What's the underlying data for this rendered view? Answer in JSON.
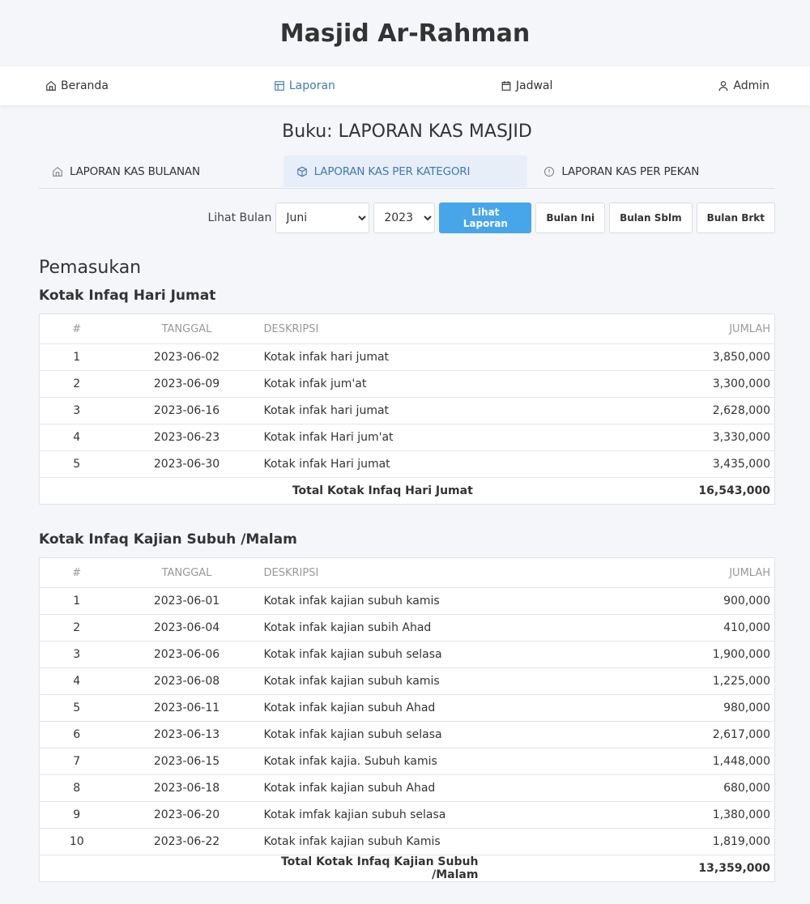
{
  "app_title": "Masjid Ar-Rahman",
  "nav": [
    {
      "label": "Beranda",
      "icon": "home-icon"
    },
    {
      "label": "Laporan",
      "icon": "layout-icon",
      "active": true
    },
    {
      "label": "Jadwal",
      "icon": "calendar-icon"
    },
    {
      "label": "Admin",
      "icon": "user-icon"
    }
  ],
  "page_title": "Buku: LAPORAN KAS MASJID",
  "tabs": [
    {
      "label": "LAPORAN KAS BULANAN",
      "icon": "home-icon"
    },
    {
      "label": "LAPORAN KAS PER KATEGORI",
      "icon": "box-icon",
      "active": true
    },
    {
      "label": "LAPORAN KAS PER PEKAN",
      "icon": "alert-circle-icon"
    }
  ],
  "controls": {
    "label": "Lihat Bulan",
    "month": "Juni",
    "year": "2023",
    "view": "Lihat Laporan",
    "this_month": "Bulan Ini",
    "prev": "Bulan Sblm",
    "next": "Bulan Brkt"
  },
  "accent": "#47a6ea",
  "section": "Pemasukan",
  "columns": [
    "#",
    "TANGGAL",
    "DESKRIPSI",
    "JUMLAH"
  ],
  "categories": [
    {
      "title": "Kotak Infaq Hari Jumat",
      "rows": [
        [
          "1",
          "2023-06-02",
          "Kotak infak hari jumat",
          "3,850,000"
        ],
        [
          "2",
          "2023-06-09",
          "Kotak infak jum'at",
          "3,300,000"
        ],
        [
          "3",
          "2023-06-16",
          "Kotak infak hari jumat",
          "2,628,000"
        ],
        [
          "4",
          "2023-06-23",
          "Kotak infak Hari jum'at",
          "3,330,000"
        ],
        [
          "5",
          "2023-06-30",
          "Kotak infak Hari jumat",
          "3,435,000"
        ]
      ],
      "total_label": "Total Kotak Infaq Hari Jumat",
      "total": "16,543,000"
    },
    {
      "title": "Kotak Infaq Kajian Subuh /Malam",
      "rows": [
        [
          "1",
          "2023-06-01",
          "Kotak infak kajian subuh kamis",
          "900,000"
        ],
        [
          "2",
          "2023-06-04",
          "Kotak infak kajian subih Ahad",
          "410,000"
        ],
        [
          "3",
          "2023-06-06",
          "Kotak infak kajian subuh selasa",
          "1,900,000"
        ],
        [
          "4",
          "2023-06-08",
          "Kotak infak kajian subuh kamis",
          "1,225,000"
        ],
        [
          "5",
          "2023-06-11",
          "Kotak infak kajian subuh Ahad",
          "980,000"
        ],
        [
          "6",
          "2023-06-13",
          "Kotak infak kajian subuh selasa",
          "2,617,000"
        ],
        [
          "7",
          "2023-06-15",
          "Kotak infak kajia. Subuh kamis",
          "1,448,000"
        ],
        [
          "8",
          "2023-06-18",
          "Kotak infak kajian subuh Ahad",
          "680,000"
        ],
        [
          "9",
          "2023-06-20",
          "Kotak imfak kajian subuh selasa",
          "1,380,000"
        ],
        [
          "10",
          "2023-06-22",
          "Kotak infak kajian subuh Kamis",
          "1,819,000"
        ]
      ],
      "total_label": "Total Kotak Infaq Kajian Subuh /Malam",
      "total": "13,359,000"
    }
  ]
}
